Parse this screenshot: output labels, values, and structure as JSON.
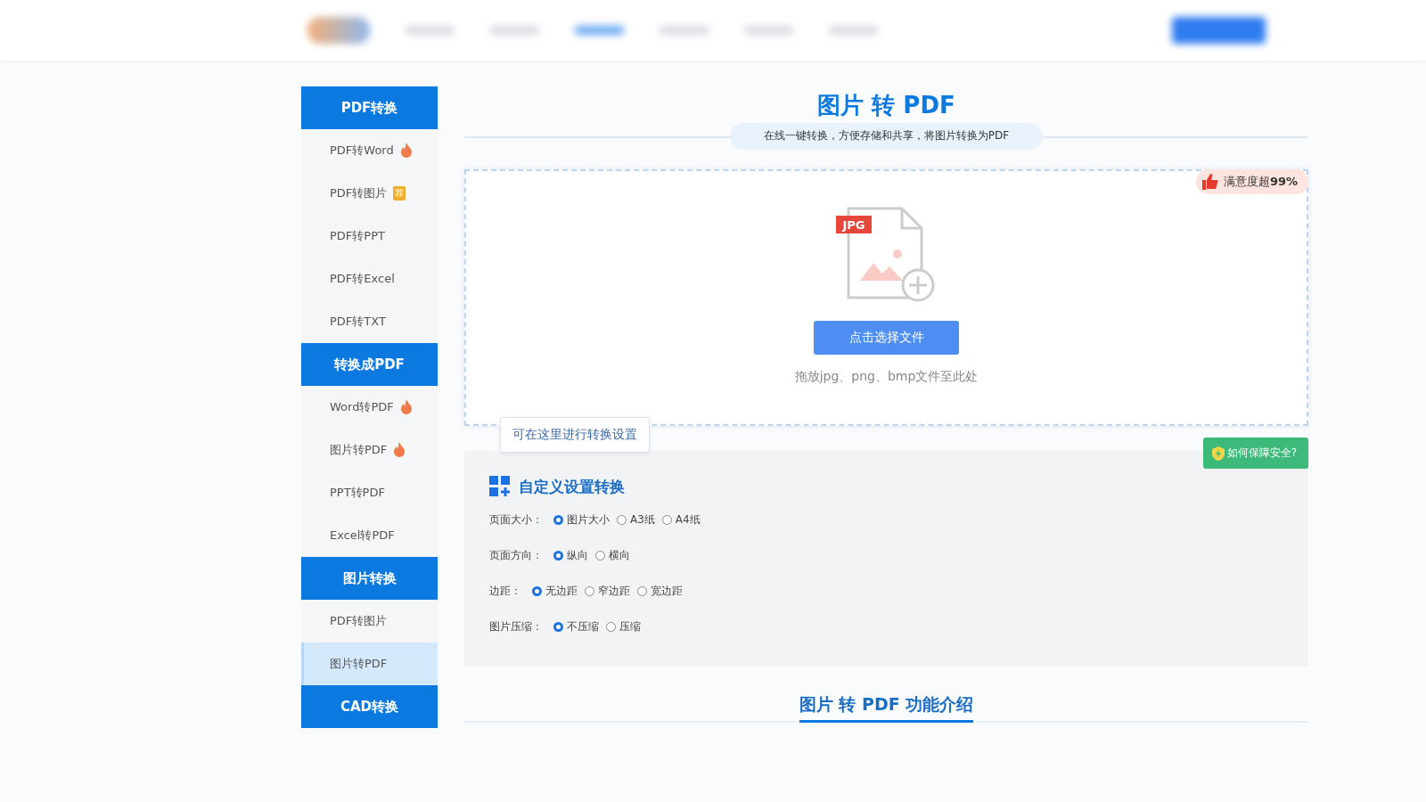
{
  "sidebar": {
    "groups": [
      {
        "title": "PDF转换",
        "items": [
          {
            "label": "PDF转Word",
            "selected": false,
            "badge": {
              "kind": "hot"
            }
          },
          {
            "label": "PDF转图片",
            "selected": false,
            "badge": {
              "kind": "tag",
              "text": "荐"
            }
          },
          {
            "label": "PDF转PPT",
            "selected": false
          },
          {
            "label": "PDF转Excel",
            "selected": false
          },
          {
            "label": "PDF转TXT",
            "selected": false
          }
        ]
      },
      {
        "title": "转换成PDF",
        "items": [
          {
            "label": "Word转PDF",
            "selected": false,
            "badge": {
              "kind": "hot"
            }
          },
          {
            "label": "图片转PDF",
            "selected": false,
            "badge": {
              "kind": "hot"
            }
          },
          {
            "label": "PPT转PDF",
            "selected": false
          },
          {
            "label": "Excel转PDF",
            "selected": false
          }
        ]
      },
      {
        "title": "图片转换",
        "items": [
          {
            "label": "PDF转图片",
            "selected": false
          },
          {
            "label": "图片转PDF",
            "selected": true
          }
        ]
      },
      {
        "title": "CAD转换"
      }
    ]
  },
  "main": {
    "title": "图片 转 PDF",
    "subtitle": "在线一键转换，方便存储和共享，将图片转换为PDF",
    "upload": {
      "satisfaction": "满意度超**99%**",
      "file_type": "JPG",
      "button": "点击选择文件",
      "hint": "拖放jpg、png、bmp文件至此处"
    },
    "tooltip": "可在这里进行转换设置",
    "security_button": "如何保障安全?",
    "settings": {
      "title": "自定义设置转换",
      "rows": [
        {
          "label": "页面大小：",
          "options": [
            {
              "label": "图片大小",
              "selected": true
            },
            {
              "label": "A3纸",
              "selected": false
            },
            {
              "label": "A4纸",
              "selected": false
            }
          ]
        },
        {
          "label": "页面方向：",
          "options": [
            {
              "label": "纵向",
              "selected": true
            },
            {
              "label": "横向",
              "selected": false
            }
          ]
        },
        {
          "label": "边距：",
          "options": [
            {
              "label": "无边距",
              "selected": true
            },
            {
              "label": "窄边距",
              "selected": false
            },
            {
              "label": "宽边距",
              "selected": false
            }
          ]
        },
        {
          "label": "图片压缩：",
          "options": [
            {
              "label": "不压缩",
              "selected": true
            },
            {
              "label": "压缩",
              "selected": false
            }
          ]
        }
      ]
    },
    "section_title": "图片 转 PDF 功能介绍"
  }
}
